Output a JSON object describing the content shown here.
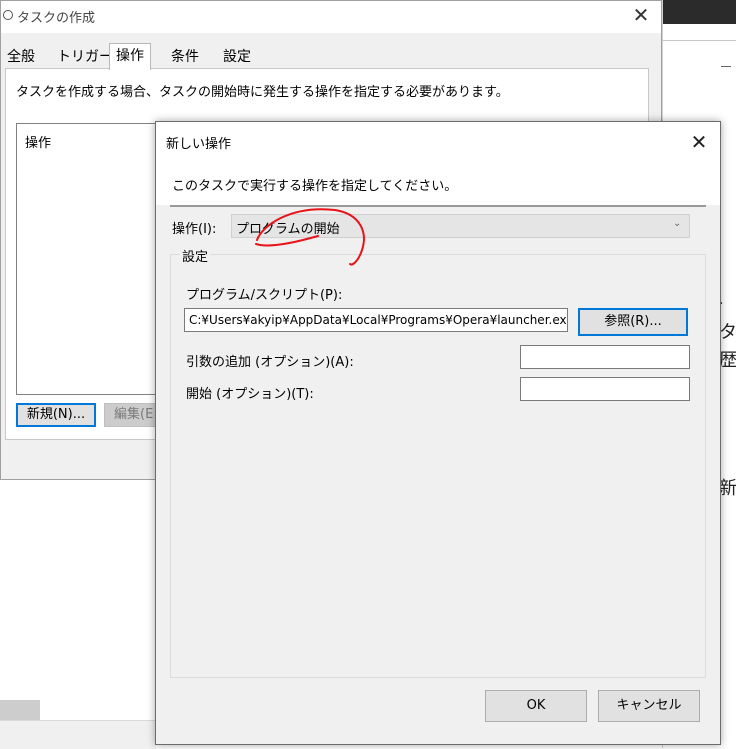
{
  "background_window": {
    "fragments": {
      "ta": "タ",
      "reki": "歴を",
      "shin": "新",
      "dot": "."
    }
  },
  "parent_window": {
    "title": "タスクの作成",
    "close_glyph": "✕",
    "tabs": [
      {
        "label": "全般"
      },
      {
        "label": "トリガー"
      },
      {
        "label": "操作"
      },
      {
        "label": "条件"
      },
      {
        "label": "設定"
      }
    ],
    "active_tab": "操作",
    "description": "タスクを作成する場合、タスクの開始時に発生する操作を指定する必要があります。",
    "list_header": "操作",
    "new_button": "新規(N)...",
    "edit_button": "編集(E"
  },
  "dialog": {
    "title": "新しい操作",
    "close_glyph": "✕",
    "instruction": "このタスクで実行する操作を指定してください。",
    "action_label": "操作(I):",
    "action_value": "プログラムの開始",
    "dropdown_glyph": "⌄",
    "group_label": "設定",
    "program_label": "プログラム/スクリプト(P):",
    "program_value": "C:¥Users¥akyip¥AppData¥Local¥Programs¥Opera¥launcher.exe",
    "browse_button": "参照(R)...",
    "args_label": "引数の追加 (オプション)(A):",
    "args_value": "",
    "start_label": "開始 (オプション)(T):",
    "start_value": "",
    "ok_button": "OK",
    "cancel_button": "キャンセル"
  },
  "colors": {
    "focus_border": "#0078d7",
    "annotation_circle": "#e8141a"
  }
}
